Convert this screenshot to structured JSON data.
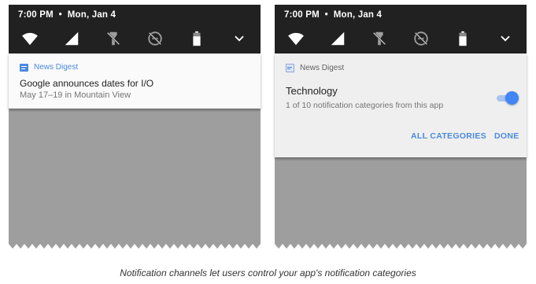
{
  "left_phone": {
    "status": {
      "time": "7:00 PM",
      "date": "Mon, Jan 4"
    },
    "quick_settings": [
      "wifi-icon",
      "cell-signal-icon",
      "flashlight-off-icon",
      "do-not-disturb-off-icon",
      "battery-icon",
      "expand-chevron-icon"
    ],
    "notification": {
      "app_name": "News Digest",
      "title": "Google announces dates for I/O",
      "text": "May 17–19 in Mountain View"
    }
  },
  "right_phone": {
    "status": {
      "time": "7:00 PM",
      "date": "Mon, Jan 4"
    },
    "quick_settings": [
      "wifi-icon",
      "cell-signal-icon",
      "flashlight-off-icon",
      "do-not-disturb-off-icon",
      "battery-icon",
      "expand-chevron-icon"
    ],
    "channel_settings": {
      "app_name": "News Digest",
      "channel_name": "Technology",
      "channel_summary": "1 of 10 notification categories from this app",
      "toggle_on": true,
      "all_categories_label": "ALL CATEGORIES",
      "done_label": "DONE"
    }
  },
  "caption": "Notification channels let users control your app's notification categories",
  "colors": {
    "statusbar": "#212121",
    "shade": "#9e9e9e",
    "accent": "#4285f4",
    "action_text": "#4a89dc"
  }
}
